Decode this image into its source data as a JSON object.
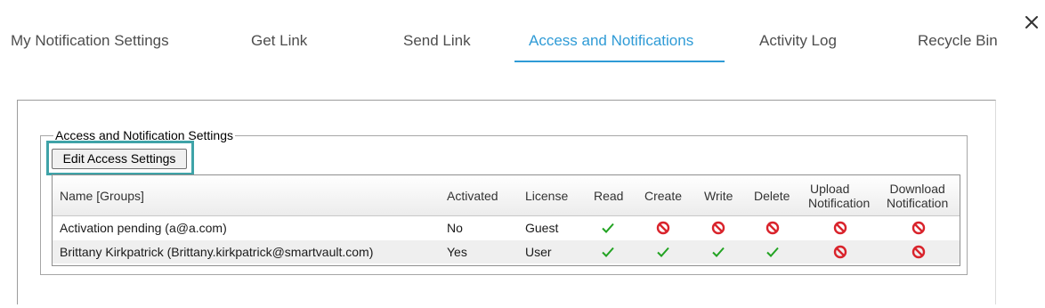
{
  "tabs": [
    {
      "label": "My Notification Settings",
      "active": false
    },
    {
      "label": "Get Link",
      "active": false
    },
    {
      "label": "Send Link",
      "active": false
    },
    {
      "label": "Access and Notifications",
      "active": true
    },
    {
      "label": "Activity Log",
      "active": false
    },
    {
      "label": "Recycle Bin",
      "active": false
    }
  ],
  "close_icon": "close-icon",
  "colors": {
    "active_tab": "#2f9bd6",
    "highlight": "#3fa3a8",
    "check": "#22a322",
    "deny": "#d9232b"
  },
  "section": {
    "legend": "Access and Notification Settings",
    "edit_button": "Edit Access Settings"
  },
  "table": {
    "headers": {
      "name": "Name [Groups]",
      "activated": "Activated",
      "license": "License",
      "read": "Read",
      "create": "Create",
      "write": "Write",
      "delete": "Delete",
      "upload_1": "Upload",
      "upload_2": "Notification",
      "download_1": "Download",
      "download_2": "Notification"
    },
    "rows": [
      {
        "name": "Activation pending (a@a.com)",
        "activated": "No",
        "license": "Guest",
        "read": "check-icon",
        "create": "deny-icon",
        "write": "deny-icon",
        "delete": "deny-icon",
        "upload_notification": "deny-icon",
        "download_notification": "deny-icon"
      },
      {
        "name": "Brittany Kirkpatrick (Brittany.kirkpatrick@smartvault.com)",
        "activated": "Yes",
        "license": "User",
        "read": "check-icon",
        "create": "check-icon",
        "write": "check-icon",
        "delete": "check-icon",
        "upload_notification": "deny-icon",
        "download_notification": "deny-icon"
      }
    ]
  }
}
